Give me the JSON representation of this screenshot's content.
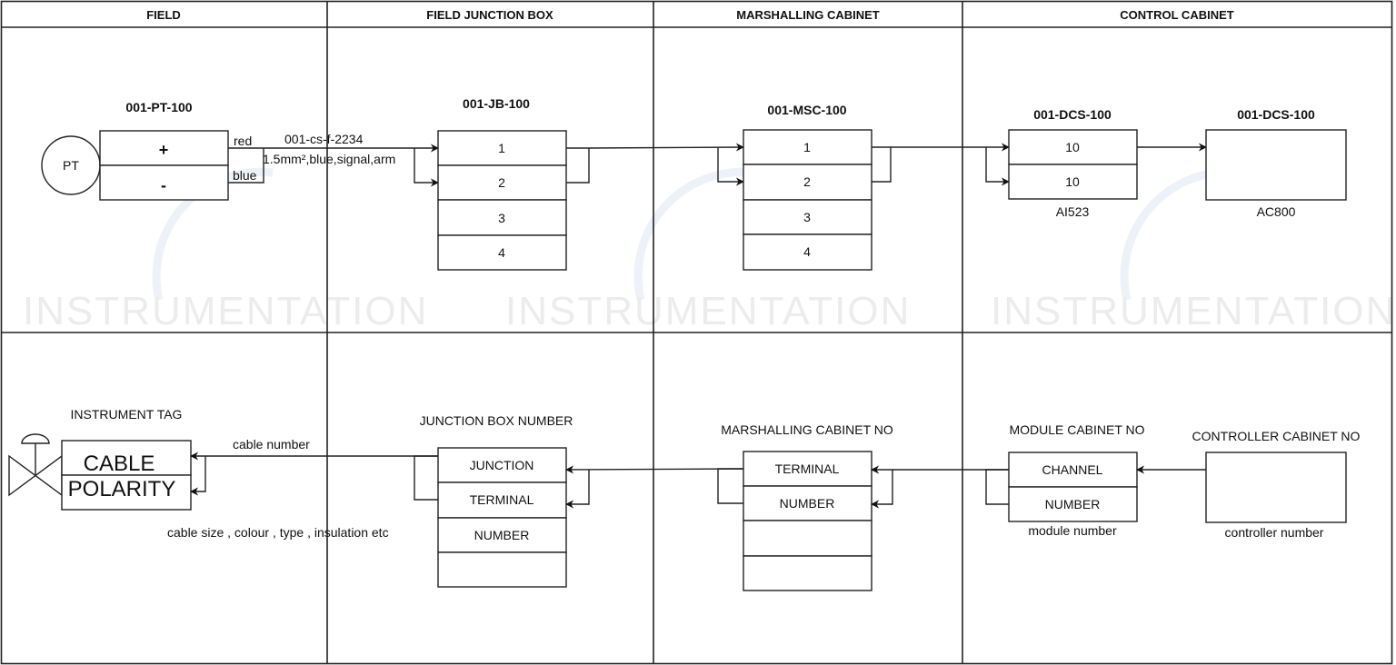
{
  "columns": [
    {
      "title": "FIELD"
    },
    {
      "title": "FIELD JUNCTION BOX"
    },
    {
      "title": "MARSHALLING CABINET"
    },
    {
      "title": "CONTROL CABINET"
    }
  ],
  "watermark": {
    "text": "INSTRUMENTATION",
    "color": "#ececec"
  },
  "example": {
    "transmitter": {
      "symbol_label": "PT",
      "tag": "001-PT-100",
      "terminals": [
        "+",
        "-"
      ],
      "wire_colors": [
        "red",
        "blue"
      ]
    },
    "cable": {
      "number": "001-cs-f-2234",
      "spec": "1.5mm²,blue,signal,arm"
    },
    "junction_box": {
      "tag": "001-JB-100",
      "terminals": [
        "1",
        "2",
        "3",
        "4"
      ]
    },
    "marshalling_cabinet": {
      "tag": "001-MSC-100",
      "terminals": [
        "1",
        "2",
        "3",
        "4"
      ]
    },
    "io_module": {
      "tag": "001-DCS-100",
      "channels": [
        "10",
        "10"
      ],
      "model": "AI523"
    },
    "controller": {
      "tag": "001-DCS-100",
      "model": "AC800"
    }
  },
  "legend": {
    "instrument": {
      "title": "INSTRUMENT TAG",
      "rows": [
        "CABLE",
        "POLARITY"
      ],
      "cable_label": "cable number",
      "cable_note": "cable size , colour , type , insulation etc"
    },
    "junction_box": {
      "title": "JUNCTION BOX NUMBER",
      "rows": [
        "JUNCTION",
        "TERMINAL",
        "NUMBER",
        ""
      ]
    },
    "marshalling_cabinet": {
      "title": "MARSHALLING CABINET NO",
      "rows": [
        "TERMINAL",
        "NUMBER",
        "",
        ""
      ]
    },
    "module": {
      "title": "MODULE CABINET NO",
      "rows": [
        "CHANNEL",
        "NUMBER"
      ],
      "note": "module number"
    },
    "controller": {
      "title": "CONTROLLER CABINET NO",
      "note": "controller number"
    }
  }
}
